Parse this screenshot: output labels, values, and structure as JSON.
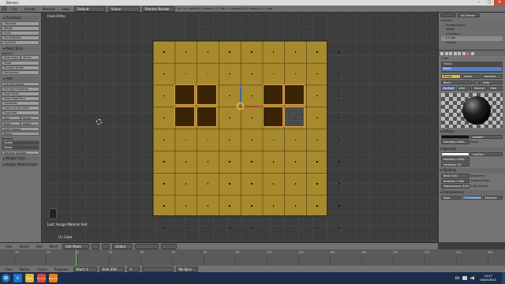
{
  "window": {
    "title": "Blender",
    "minimize": "–",
    "maximize": "▢",
    "close": "✕"
  },
  "info_header": {
    "menus": [
      "File",
      "Render",
      "Window",
      "Help"
    ],
    "layout": "Default",
    "scene": "Scene",
    "render_engine": "Blender Render",
    "stats": "v2.74 | Verts:0/2 | Faces:1/1 | Tris:1 | Objects:1/3 | Lamp:1/1 | Cube"
  },
  "tool_shelf": {
    "sections": [
      {
        "header": "▾ Transform",
        "buttons": [
          "Translate",
          "Rotate",
          "Scale",
          "Shrink/Fatten",
          "Push/Pull"
        ]
      },
      {
        "header": "▾ Mesh Tools",
        "buttons": [
          "Deform:",
          "Slide Edge",
          "Vertex",
          "Noise",
          "Smooth Vertex",
          "Randomize"
        ]
      },
      {
        "header": "▾ Add",
        "buttons": [
          "Extrude Region",
          "Extrude Individual",
          "Inset Faces",
          "Make Edge/Face",
          "Subdivide",
          "Loop Cut and Slide",
          "Duplicate",
          "Spin",
          "Screw",
          "Knife",
          "Select",
          "Knife Project",
          "Bisect"
        ]
      },
      {
        "header": "Remove",
        "buttons": [
          "Delete",
          "Merge",
          "Remove Doubles"
        ]
      }
    ],
    "collapsed": [
      "▸ Weight Tools",
      "▸ Assign Material Slot"
    ]
  },
  "viewport": {
    "label": "Front Ortho",
    "last_operator": "Last: Assign Material Slot",
    "object_info": "(1) Cube"
  },
  "outliner": {
    "search_placeholder": "All Scenes",
    "items": [
      "▾ Scene",
      "  RenderLayers",
      "  World",
      "▾ Camera",
      "▾ Cube",
      "▾ Lamp"
    ]
  },
  "properties": {
    "object": "Cube",
    "materials": [
      "Yellow",
      "Black"
    ],
    "buttons": [
      "Assign",
      "Select",
      "Deselect"
    ],
    "material_name": "Black",
    "data_user": "Data",
    "users": "2",
    "tabs": [
      "Surface",
      "Wire",
      "Volume",
      "Halo"
    ],
    "diffuse_header": "▾ Diffuse",
    "diffuse_shader": "Lambert",
    "intensity": "Intensity: 0.800",
    "ramp": "Ramp",
    "specular_header": "▾ Specular",
    "specular_shader": "CookTorr",
    "spec_intensity": "Intensity: 0.500",
    "hardness": "Hardness: 50",
    "shading_header": "▾ Shading",
    "emit": "Emit: 0.00",
    "ambient": "Ambient: 1.000",
    "translucency": "Translucency: 0.000",
    "shadeless": "Shadeless",
    "tangent_shading": "Tangent Shad...",
    "cubic": "Cubic Interp...",
    "transparency_header": "▾ Transparency",
    "trans_modes": [
      "Mask",
      "Z Transparency",
      "Raytrace"
    ]
  },
  "viewport_header": {
    "menus": [
      "View",
      "Select",
      "Add",
      "Mesh"
    ],
    "mode": "Edit Mode",
    "pivot": "Global"
  },
  "timeline": {
    "ticks": [
      "-40",
      "-20",
      "0",
      "20",
      "40",
      "60",
      "80",
      "100",
      "120",
      "140",
      "160",
      "180",
      "200",
      "220",
      "240",
      "260"
    ],
    "current_frame": "1"
  },
  "timeline_header": {
    "menus": [
      "View",
      "Marker",
      "Frame",
      "Playback"
    ],
    "start": "Start: 1",
    "end": "End: 250",
    "frame": "1",
    "sync": "No Sync"
  },
  "taskbar": {
    "apps": [
      "IE",
      "Files",
      "Chrome",
      "Blender"
    ],
    "colors": [
      "#1f6fd1",
      "#e0b23a",
      "#d94a38",
      "#e87d0d"
    ],
    "tray_lang": "EN",
    "clock_time": "10:47",
    "clock_date": "06/05/2015"
  },
  "colors": {
    "face_yellow": "#a88a2e",
    "face_selected": "#3b2405",
    "selected_edge": "#d1a050"
  }
}
